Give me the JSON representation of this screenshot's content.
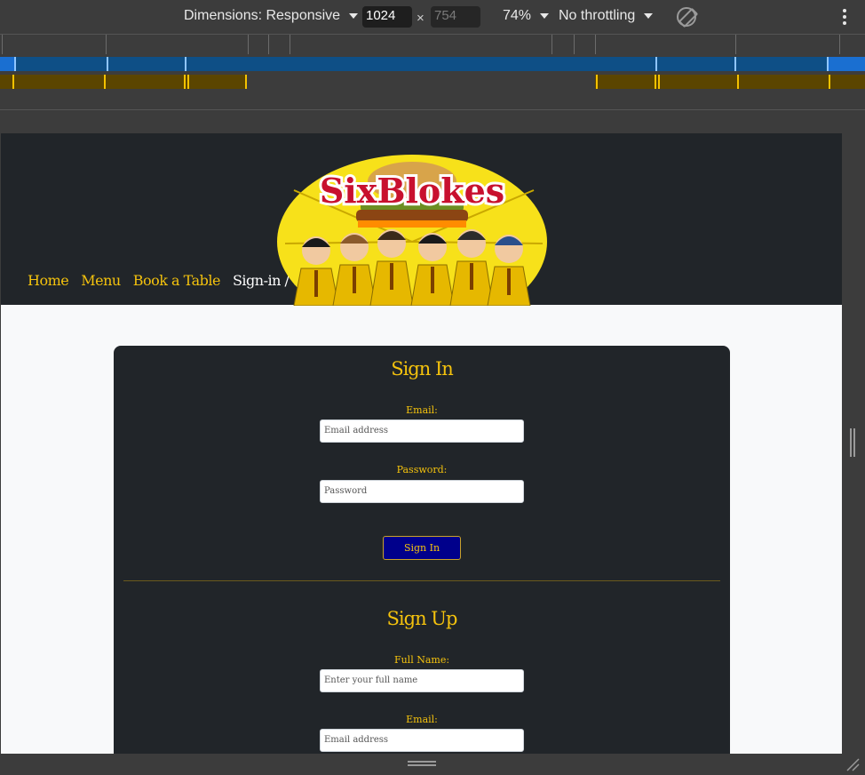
{
  "devtools": {
    "dimensions_label": "Dimensions: Responsive",
    "width_value": "1024",
    "height_value": "754",
    "times_symbol": "×",
    "zoom_label": "74%",
    "throttle_label": "No throttling",
    "icons": [
      "rotate-icon",
      "more-options-icon",
      "resize-handle-icon"
    ]
  },
  "site": {
    "logo_text": "SixBlokes",
    "nav": [
      "Home",
      "Menu",
      "Book a Table",
      "Sign-in / Sign-up"
    ],
    "colors": {
      "accent": "#f4c20d",
      "header_bg": "#212529",
      "button_bg": "#00008b"
    }
  },
  "signin": {
    "heading": "Sign In",
    "email_label": "Email:",
    "email_placeholder": "Email address",
    "password_label": "Password:",
    "password_placeholder": "Password",
    "button": "Sign In"
  },
  "signup": {
    "heading": "Sign Up",
    "fullname_label": "Full Name:",
    "fullname_placeholder": "Enter your full name",
    "email_label": "Email:",
    "email_placeholder": "Email address"
  }
}
